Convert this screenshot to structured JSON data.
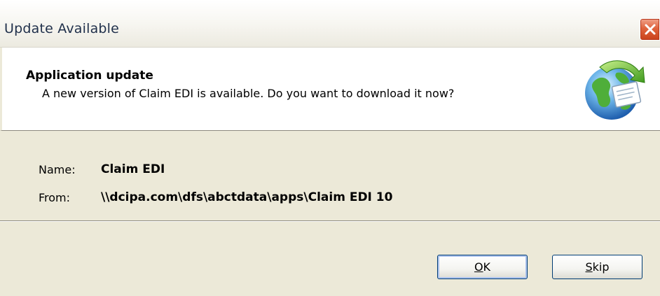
{
  "window": {
    "title": "Update Available"
  },
  "header": {
    "title": "Application update",
    "description": "A new version of Claim EDI is available. Do you want to download it now?",
    "icon": "globe-update-icon"
  },
  "details": {
    "name_label": "Name:",
    "name_value": "Claim EDI",
    "from_label": "From:",
    "from_value": "\\\\dcipa.com\\dfs\\abctdata\\apps\\Claim EDI 10"
  },
  "buttons": {
    "ok": {
      "mnemonic": "O",
      "rest": "K"
    },
    "skip": {
      "mnemonic": "S",
      "rest": "kip"
    }
  },
  "colors": {
    "window_bg": "#ece9d8",
    "close_button": "#e0643d",
    "button_border": "#003c74"
  }
}
